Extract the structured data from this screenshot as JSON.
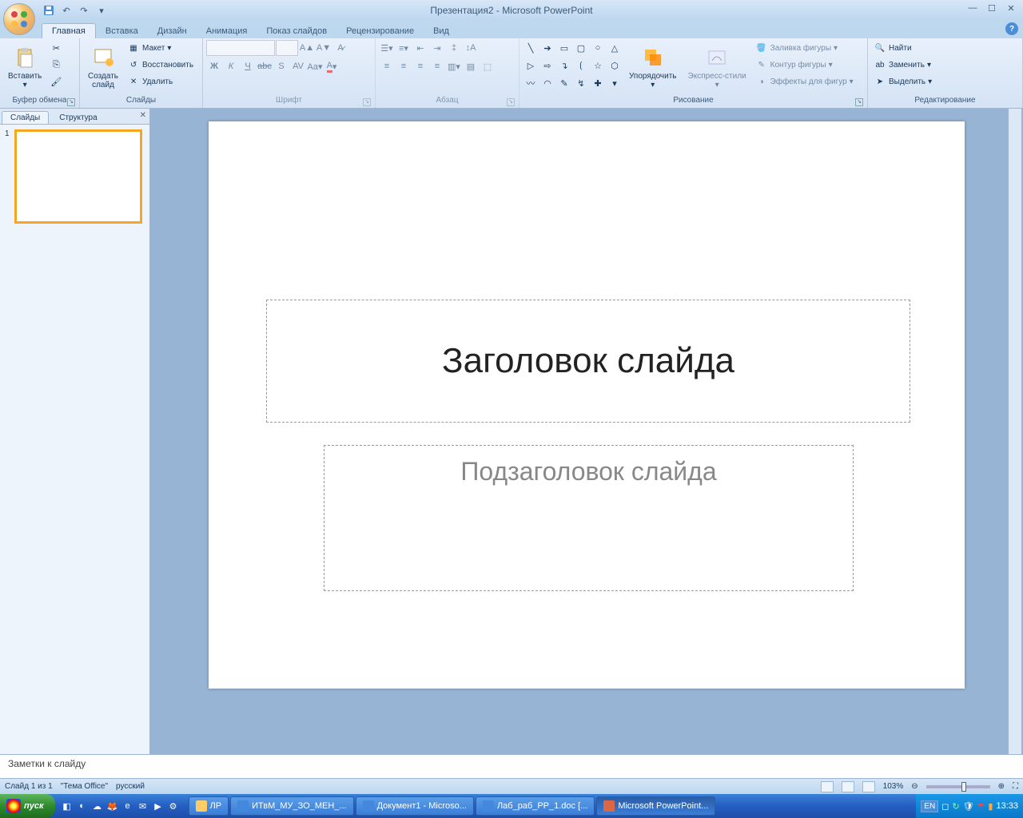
{
  "title": {
    "doc": "Презентация2",
    "app": "Microsoft PowerPoint",
    "full": "Презентация2 - Microsoft PowerPoint"
  },
  "tabs": [
    "Главная",
    "Вставка",
    "Дизайн",
    "Анимация",
    "Показ слайдов",
    "Рецензирование",
    "Вид"
  ],
  "active_tab": 0,
  "ribbon": {
    "clipboard": {
      "label": "Буфер обмена",
      "paste": "Вставить"
    },
    "slides": {
      "label": "Слайды",
      "new": "Создать\nслайд",
      "layout": "Макет",
      "reset": "Восстановить",
      "delete": "Удалить"
    },
    "font": {
      "label": "Шрифт"
    },
    "paragraph": {
      "label": "Абзац"
    },
    "drawing": {
      "label": "Рисование",
      "arrange": "Упорядочить",
      "quick": "Экспресс-стили",
      "fill": "Заливка фигуры",
      "outline": "Контур фигуры",
      "effects": "Эффекты для фигур"
    },
    "editing": {
      "label": "Редактирование",
      "find": "Найти",
      "replace": "Заменить",
      "select": "Выделить"
    }
  },
  "sidepanel": {
    "tab_slides": "Слайды",
    "tab_outline": "Структура",
    "thumb_num": "1"
  },
  "slide": {
    "title": "Заголовок слайда",
    "subtitle": "Подзаголовок слайда"
  },
  "notes": "Заметки к слайду",
  "status": {
    "slide": "Слайд 1 из 1",
    "theme": "\"Тема Office\"",
    "lang": "русский",
    "zoom": "103%"
  },
  "taskbar": {
    "start": "пуск",
    "tasks": [
      {
        "label": "ЛР",
        "icon": "folder"
      },
      {
        "label": "ИТвМ_МУ_ЗО_МЕН_...",
        "icon": "word"
      },
      {
        "label": "Документ1 - Microso...",
        "icon": "word"
      },
      {
        "label": "Лаб_раб_РР_1.doc [...",
        "icon": "word"
      },
      {
        "label": "Microsoft PowerPoint...",
        "icon": "pp",
        "active": true
      }
    ],
    "lang": "EN",
    "clock": "13:33"
  }
}
